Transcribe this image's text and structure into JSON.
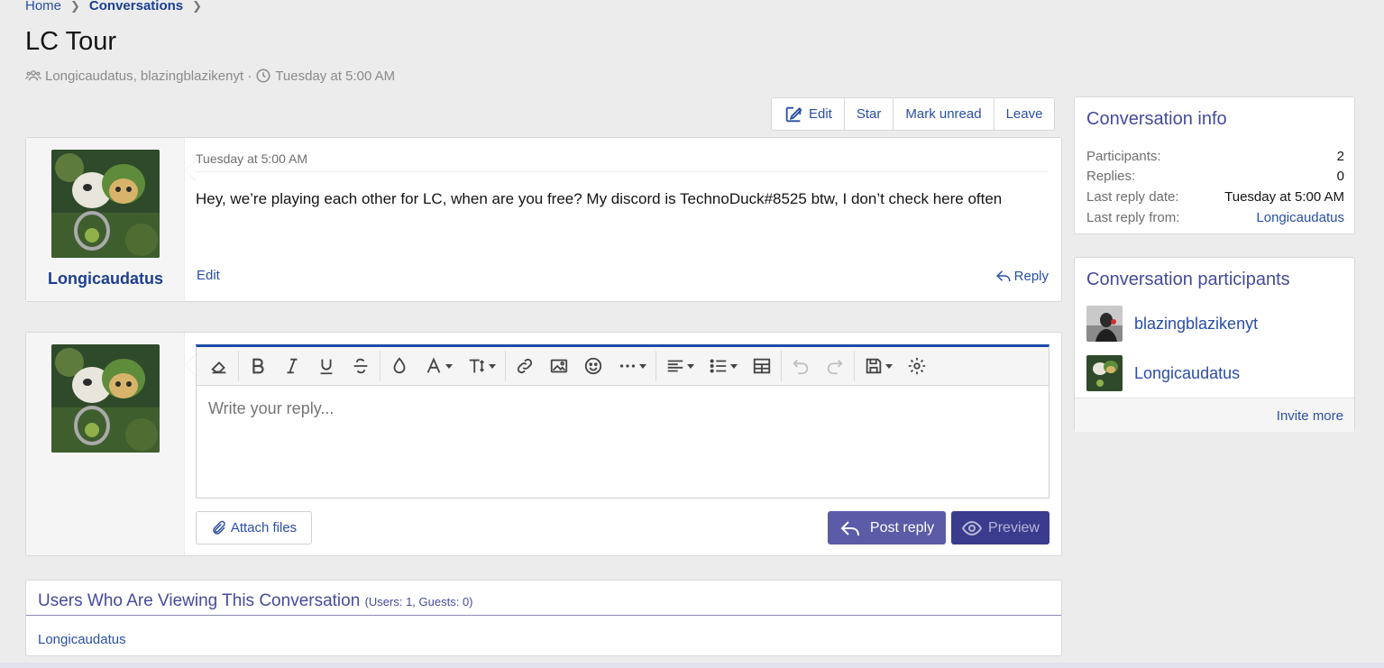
{
  "breadcrumb": {
    "home": "Home",
    "current": "Conversations"
  },
  "page": {
    "title": "LC Tour",
    "participants_meta": "Longicaudatus, blazingblazikenyt ·",
    "date_meta": "Tuesday at 5:00 AM"
  },
  "actions": {
    "edit": "Edit",
    "star": "Star",
    "mark_unread": "Mark unread",
    "leave": "Leave"
  },
  "message": {
    "author": "Longicaudatus",
    "date": "Tuesday at 5:00 AM",
    "body": "Hey, we’re playing each other for LC, when are you free? My discord is TechnoDuck#8525 btw, I don’t check here often",
    "edit_label": "Edit",
    "reply_label": "Reply"
  },
  "reply_editor": {
    "placeholder": "Write your reply...",
    "attach_label": "Attach files",
    "post_label": "Post reply",
    "preview_label": "Preview"
  },
  "viewers": {
    "title": "Users Who Are Viewing This Conversation",
    "counts": "(Users: 1, Guests: 0)",
    "names": "Longicaudatus"
  },
  "conversation_info": {
    "title": "Conversation info",
    "participants_label": "Participants:",
    "participants_value": "2",
    "replies_label": "Replies:",
    "replies_value": "0",
    "last_reply_date_label": "Last reply date:",
    "last_reply_date_value": "Tuesday at 5:00 AM",
    "last_reply_from_label": "Last reply from:",
    "last_reply_from_value": "Longicaudatus"
  },
  "participants_block": {
    "title": "Conversation participants",
    "users": [
      "blazingblazikenyt",
      "Longicaudatus"
    ],
    "invite_label": "Invite more"
  },
  "colors": {
    "link": "#2a4ea6",
    "accent": "#454b9a",
    "post_button": "#5b5ba8",
    "preview_button": "#3b3b8d",
    "editor_border": "#1d4aa8"
  }
}
